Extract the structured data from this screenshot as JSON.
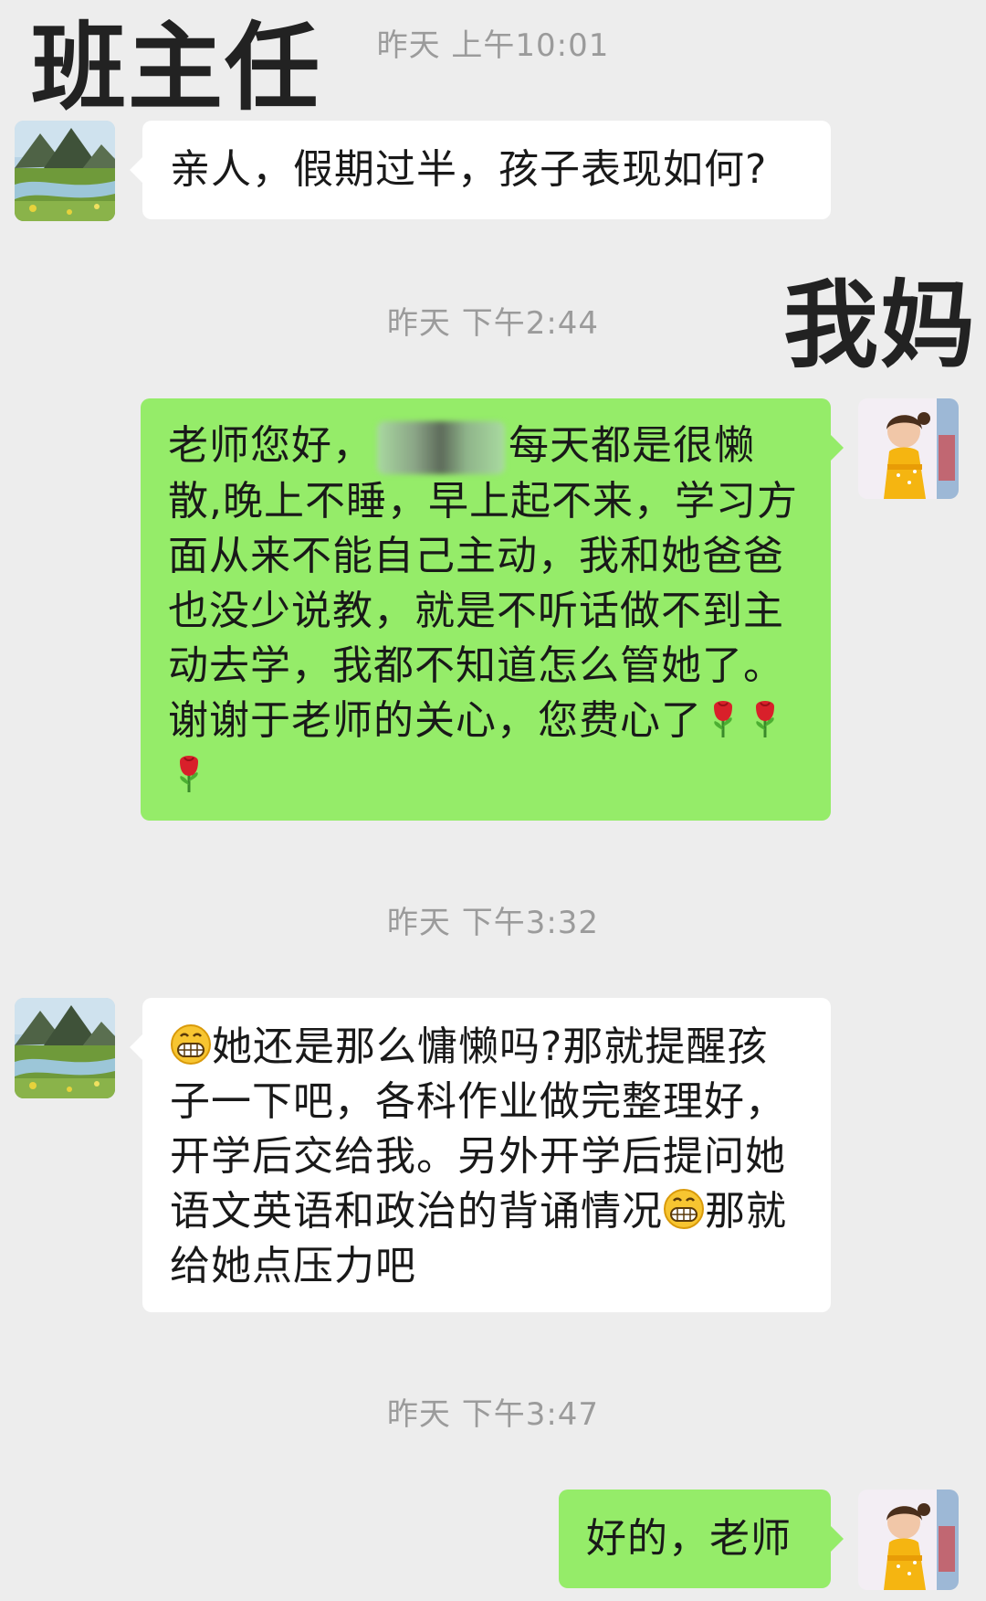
{
  "overlay_labels": {
    "teacher": "班主任",
    "mom": "我妈"
  },
  "messages": [
    {
      "timestamp": "昨天 上午10:01",
      "sender": "teacher",
      "text": "亲人，假期过半，孩子表现如何?"
    },
    {
      "timestamp": "昨天 下午2:44",
      "sender": "mom",
      "text_before_blur": "老师您好，",
      "text_after_blur": "每天都是很懒散,晚上不睡，早上起不来，学习方面从来不能自己主动，我和她爸爸也没少说教，就是不听话做不到主动去学，我都不知道怎么管她了。谢谢于老师的关心，您费心了",
      "trailing_emoji": "rose-icon",
      "trailing_emoji_count": 3
    },
    {
      "timestamp": "昨天 下午3:32",
      "sender": "teacher",
      "part1": "她还是那么慵懒吗?那就提醒孩子一下吧，各科作业做完整理好，开学后交给我。另外开学后提问她语文英语和政治的背诵情况",
      "part2": "那就给她点压力吧",
      "emoji": "grin-icon"
    },
    {
      "timestamp": "昨天 下午3:47",
      "sender": "mom",
      "text": "好的，老师"
    }
  ],
  "colors": {
    "background": "#ededed",
    "bubble_left": "#ffffff",
    "bubble_right": "#95ec69",
    "timestamp": "#9b9b9b"
  }
}
